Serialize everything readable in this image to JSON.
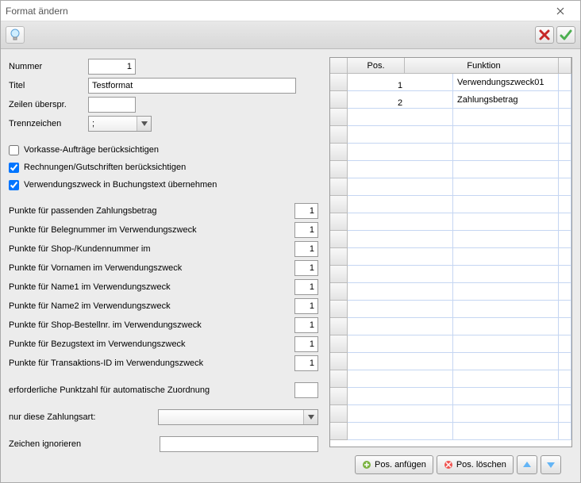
{
  "window": {
    "title": "Format ändern"
  },
  "toolbar": {
    "hint": "hint",
    "cancel": "cancel",
    "ok": "ok"
  },
  "form": {
    "nummer_label": "Nummer",
    "nummer_value": "1",
    "titel_label": "Titel",
    "titel_value": "Testformat",
    "zeilen_label": "Zeilen überspr.",
    "zeilen_value": "",
    "trenn_label": "Trennzeichen",
    "trenn_value": ";",
    "chk_vorkasse": "Vorkasse-Aufträge berücksichtigen",
    "chk_vorkasse_checked": false,
    "chk_rechnungen": "Rechnungen/Gutschriften berücksichtigen",
    "chk_rechnungen_checked": true,
    "chk_verwendungszweck": "Verwendungszweck in Buchungstext übernehmen",
    "chk_verwendungszweck_checked": true,
    "punkte": [
      {
        "label": "Punkte für passenden Zahlungsbetrag",
        "value": "1"
      },
      {
        "label": "Punkte für Belegnummer im Verwendungszweck",
        "value": "1"
      },
      {
        "label": "Punkte für Shop-/Kundennummer im",
        "value": "1"
      },
      {
        "label": "Punkte für Vornamen im Verwendungszweck",
        "value": "1"
      },
      {
        "label": "Punkte für Name1 im Verwendungszweck",
        "value": "1"
      },
      {
        "label": "Punkte für Name2 im Verwendungszweck",
        "value": "1"
      },
      {
        "label": "Punkte für Shop-Bestellnr. im Verwendungszweck",
        "value": "1"
      },
      {
        "label": "Punkte für Bezugstext im Verwendungszweck",
        "value": "1"
      },
      {
        "label": "Punkte für Transaktions-ID im Verwendungszweck",
        "value": "1"
      }
    ],
    "req_label": "erforderliche Punktzahl für automatische Zuordnung",
    "req_value": "",
    "zahlungsart_label": "nur diese Zahlungsart:",
    "zahlungsart_value": "",
    "ignore_label": "Zeichen ignorieren",
    "ignore_value": ""
  },
  "table": {
    "headers": {
      "pos": "Pos.",
      "func": "Funktion"
    },
    "rows": [
      {
        "pos": "1",
        "func": "Verwendungszweck01"
      },
      {
        "pos": "2",
        "func": "Zahlungsbetrag"
      }
    ],
    "buttons": {
      "append": "Pos. anfügen",
      "delete": "Pos. löschen"
    }
  }
}
